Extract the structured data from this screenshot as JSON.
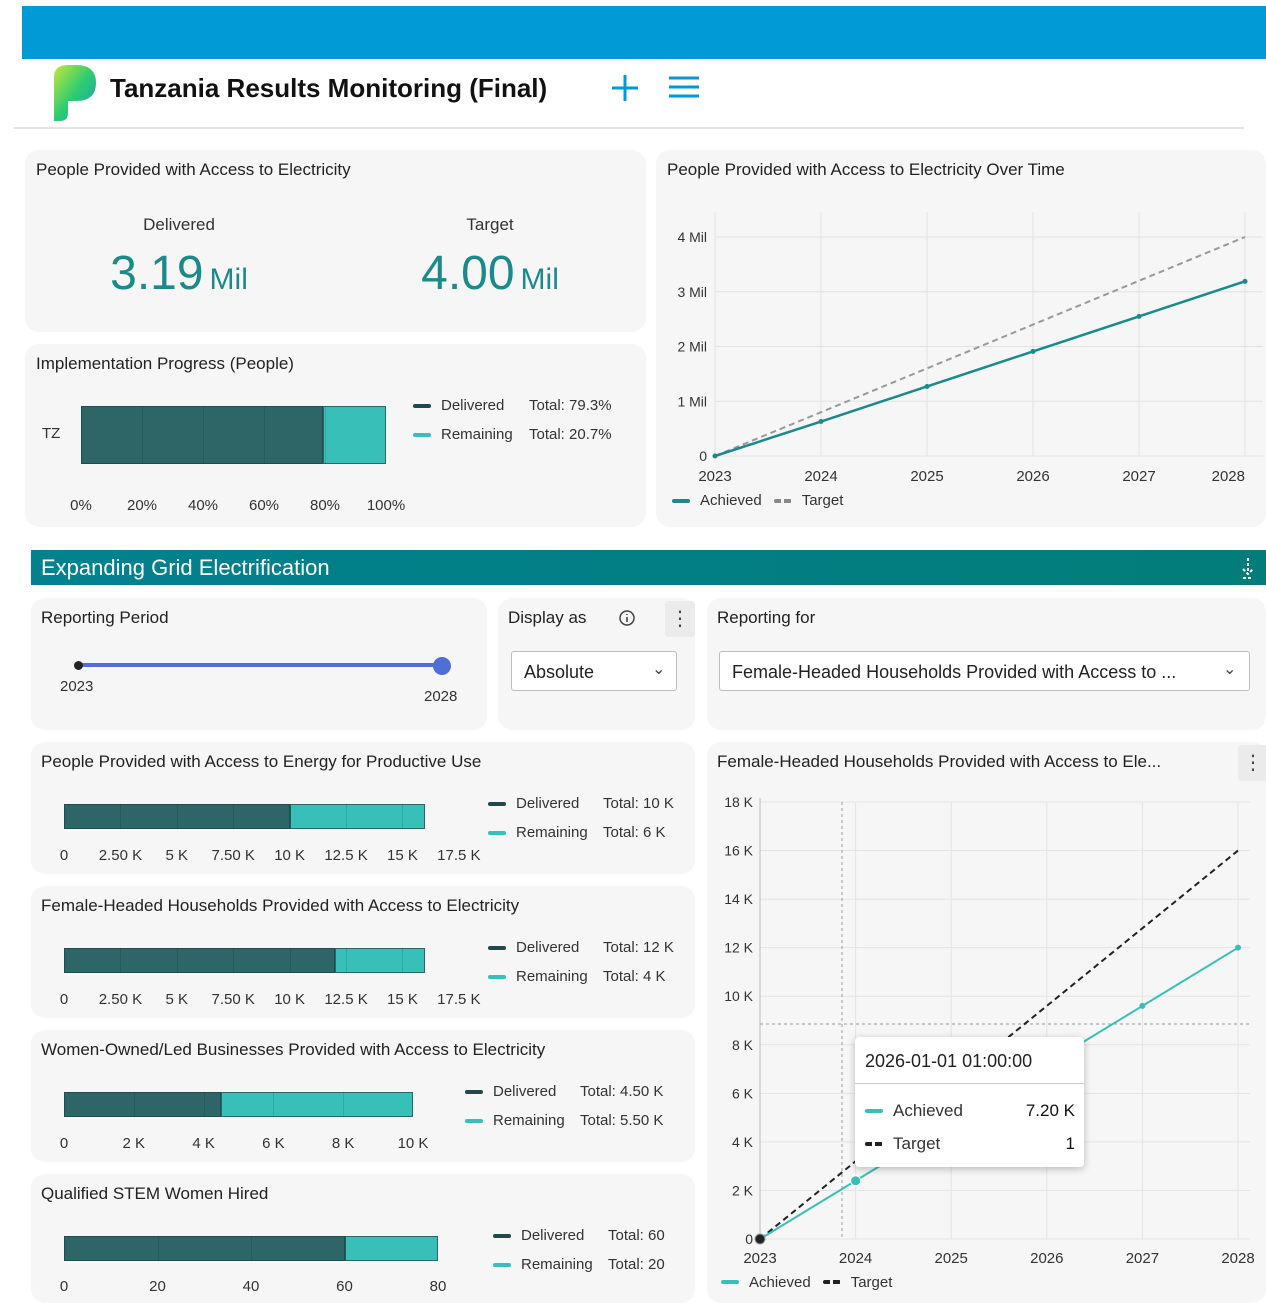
{
  "app": {
    "title": "Tanzania Results Monitoring (Final)"
  },
  "colors": {
    "header_bar": "#029ad6",
    "section_bar": "#02818f",
    "delivered": "#2e6668",
    "remaining": "#38c0b8",
    "kpi": "#1a8a8a",
    "target_line": "#9e9e9e"
  },
  "kpi": {
    "title": "People Provided with Access to Electricity",
    "delivered_label": "Delivered",
    "delivered_value": "3.19",
    "delivered_unit": "Mil",
    "target_label": "Target",
    "target_value": "4.00",
    "target_unit": "Mil"
  },
  "impl": {
    "title": "Implementation Progress (People)",
    "category": "TZ",
    "delivered_label": "Delivered",
    "delivered_total": "Total: 79.3%",
    "remaining_label": "Remaining",
    "remaining_total": "Total: 20.7%",
    "ticks": [
      "0%",
      "20%",
      "40%",
      "60%",
      "80%",
      "100%"
    ],
    "delivered_pct": 79.3
  },
  "overtime": {
    "title": "People Provided with Access to Electricity Over Time",
    "y_ticks": [
      "4 Mil",
      "3 Mil",
      "2 Mil",
      "1 Mil",
      "0"
    ],
    "x_ticks": [
      "2023",
      "2024",
      "2025",
      "2026",
      "2027",
      "2028"
    ],
    "legend_achieved": "Achieved",
    "legend_target": "Target"
  },
  "section": {
    "title": "Expanding Grid Electrification"
  },
  "filters": {
    "period_title": "Reporting Period",
    "period_start": "2023",
    "period_end": "2028",
    "display_title": "Display as",
    "display_value": "Absolute",
    "reporting_title": "Reporting for",
    "reporting_value": "Female-Headed Households Provided with Access to ..."
  },
  "mini_charts": [
    {
      "title": "People Provided with Access to Energy for Productive Use",
      "delivered_label": "Delivered",
      "delivered_total": "Total: 10 K",
      "remaining_label": "Remaining",
      "remaining_total": "Total: 6 K",
      "ticks": [
        "0",
        "2.50 K",
        "5 K",
        "7.50 K",
        "10 K",
        "12.5 K",
        "15 K",
        "17.5 K"
      ]
    },
    {
      "title": "Female-Headed Households Provided with Access to Electricity",
      "delivered_label": "Delivered",
      "delivered_total": "Total: 12 K",
      "remaining_label": "Remaining",
      "remaining_total": "Total: 4 K",
      "ticks": [
        "0",
        "2.50 K",
        "5 K",
        "7.50 K",
        "10 K",
        "12.5 K",
        "15 K",
        "17.5 K"
      ]
    },
    {
      "title": "Women-Owned/Led Businesses Provided with Access to Electricity",
      "delivered_label": "Delivered",
      "delivered_total": "Total: 4.50 K",
      "remaining_label": "Remaining",
      "remaining_total": "Total: 5.50 K",
      "ticks": [
        "0",
        "2 K",
        "4 K",
        "6 K",
        "8 K",
        "10 K"
      ]
    },
    {
      "title": "Qualified STEM Women Hired",
      "delivered_label": "Delivered",
      "delivered_total": "Total: 60",
      "remaining_label": "Remaining",
      "remaining_total": "Total: 20",
      "ticks": [
        "0",
        "20",
        "40",
        "60",
        "80"
      ]
    }
  ],
  "fhh": {
    "title": "Female-Headed Households Provided with Access to Ele...",
    "y_ticks": [
      "18 K",
      "16 K",
      "14 K",
      "12 K",
      "10 K",
      "8 K",
      "6 K",
      "4 K",
      "2 K",
      "0"
    ],
    "x_ticks": [
      "2023",
      "2024",
      "2025",
      "2026",
      "2027",
      "2028"
    ],
    "legend_achieved": "Achieved",
    "legend_target": "Target"
  },
  "tooltip": {
    "date": "2026-01-01 01:00:00",
    "achieved_label": "Achieved",
    "achieved_value": "7.20 K",
    "target_label": "Target",
    "target_value": "1"
  },
  "chart_data": [
    {
      "type": "bar",
      "orientation": "horizontal",
      "stacked": true,
      "title": "Implementation Progress (People)",
      "categories": [
        "TZ"
      ],
      "series": [
        {
          "name": "Delivered",
          "values": [
            79.3
          ]
        },
        {
          "name": "Remaining",
          "values": [
            20.7
          ]
        }
      ],
      "xlim": [
        0,
        100
      ]
    },
    {
      "type": "line",
      "title": "People Provided with Access to Electricity Over Time",
      "x": [
        2023,
        2024,
        2025,
        2026,
        2027,
        2028
      ],
      "series": [
        {
          "name": "Achieved",
          "values": [
            0,
            630000,
            1270000,
            1910000,
            2550000,
            3190000
          ]
        },
        {
          "name": "Target",
          "values": [
            0,
            800000,
            1600000,
            2400000,
            3200000,
            4000000
          ]
        }
      ],
      "ylim": [
        0,
        4000000
      ]
    },
    {
      "type": "bar",
      "orientation": "horizontal",
      "stacked": true,
      "title": "People Provided with Access to Energy for Productive Use",
      "series": [
        {
          "name": "Delivered",
          "values": [
            10000
          ]
        },
        {
          "name": "Remaining",
          "values": [
            6000
          ]
        }
      ],
      "xlim": [
        0,
        17500
      ]
    },
    {
      "type": "bar",
      "orientation": "horizontal",
      "stacked": true,
      "title": "Female-Headed Households Provided with Access to Electricity",
      "series": [
        {
          "name": "Delivered",
          "values": [
            12000
          ]
        },
        {
          "name": "Remaining",
          "values": [
            4000
          ]
        }
      ],
      "xlim": [
        0,
        17500
      ]
    },
    {
      "type": "bar",
      "orientation": "horizontal",
      "stacked": true,
      "title": "Women-Owned/Led Businesses Provided with Access to Electricity",
      "series": [
        {
          "name": "Delivered",
          "values": [
            4500
          ]
        },
        {
          "name": "Remaining",
          "values": [
            5500
          ]
        }
      ],
      "xlim": [
        0,
        10000
      ]
    },
    {
      "type": "bar",
      "orientation": "horizontal",
      "stacked": true,
      "title": "Qualified STEM Women Hired",
      "series": [
        {
          "name": "Delivered",
          "values": [
            60
          ]
        },
        {
          "name": "Remaining",
          "values": [
            20
          ]
        }
      ],
      "xlim": [
        0,
        80
      ]
    },
    {
      "type": "line",
      "title": "Female-Headed Households Provided with Access to Ele...",
      "x": [
        2023,
        2024,
        2025,
        2026,
        2027,
        2028
      ],
      "series": [
        {
          "name": "Achieved",
          "values": [
            0,
            2400,
            4800,
            7200,
            9600,
            12000
          ]
        },
        {
          "name": "Target",
          "values": [
            0,
            3200,
            6400,
            9600,
            12800,
            16000
          ]
        }
      ],
      "ylim": [
        0,
        18000
      ]
    }
  ]
}
